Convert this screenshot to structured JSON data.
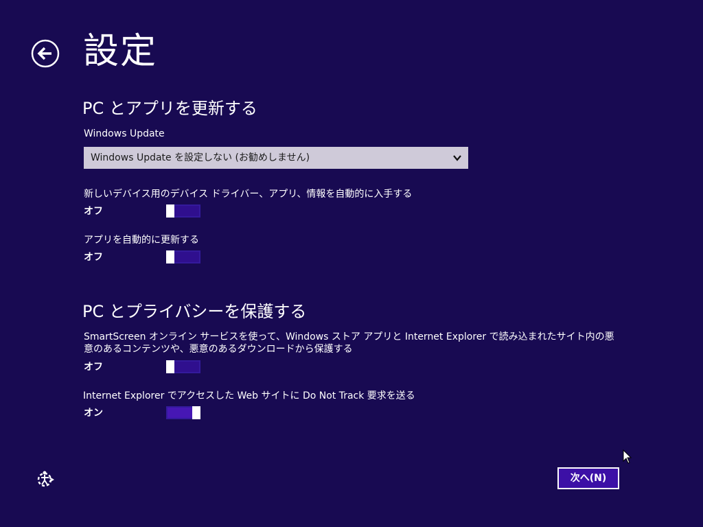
{
  "header": {
    "title": "設定",
    "back_icon": "back-arrow-icon"
  },
  "update_section": {
    "title": "PC とアプリを更新する",
    "windows_update": {
      "label": "Windows Update",
      "selected": "Windows Update を設定しない (お勧めしません)"
    },
    "driver_toggle": {
      "label": "新しいデバイス用のデバイス ドライバー、アプリ、情報を自動的に入手する",
      "state_text": "オフ",
      "on": false
    },
    "app_update_toggle": {
      "label": "アプリを自動的に更新する",
      "state_text": "オフ",
      "on": false
    }
  },
  "privacy_section": {
    "title": "PC とプライバシーを保護する",
    "smartscreen_toggle": {
      "label": "SmartScreen オンライン サービスを使って、Windows ストア アプリと Internet Explorer で読み込まれたサイト内の悪意のあるコンテンツや、悪意のあるダウンロードから保護する",
      "state_text": "オフ",
      "on": false
    },
    "dnt_toggle": {
      "label": "Internet Explorer でアクセスした Web サイトに Do Not Track 要求を送る",
      "state_text": "オン",
      "on": true
    }
  },
  "footer": {
    "ease_of_access_icon": "ease-of-access-icon",
    "next_label": "次へ(N)"
  },
  "colors": {
    "background": "#180a52",
    "accent": "#4617b4",
    "dropdown_bg": "#cfcad9"
  }
}
